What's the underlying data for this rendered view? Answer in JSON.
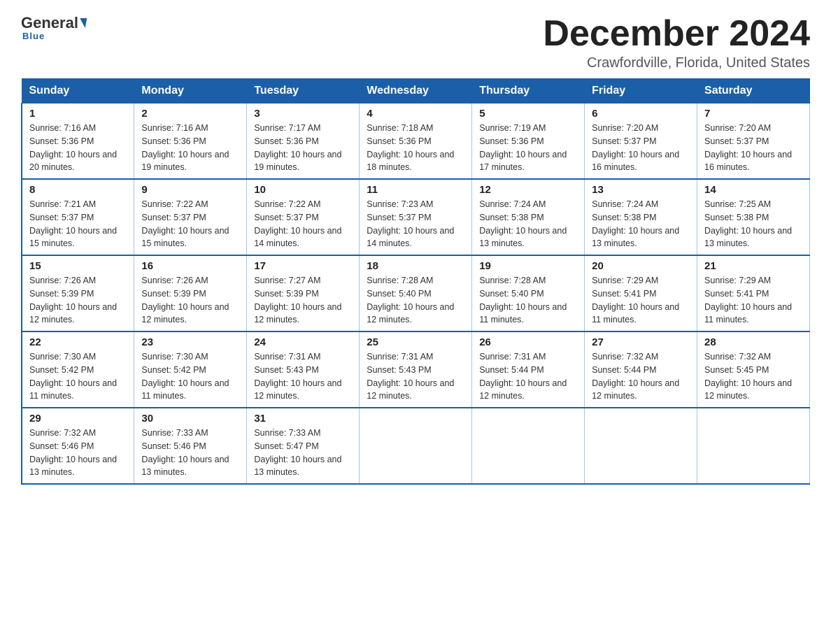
{
  "logo": {
    "general": "General",
    "blue": "Blue",
    "sub": "Blue"
  },
  "header": {
    "month_year": "December 2024",
    "location": "Crawfordville, Florida, United States"
  },
  "weekdays": [
    "Sunday",
    "Monday",
    "Tuesday",
    "Wednesday",
    "Thursday",
    "Friday",
    "Saturday"
  ],
  "weeks": [
    [
      {
        "day": "1",
        "sunrise": "Sunrise: 7:16 AM",
        "sunset": "Sunset: 5:36 PM",
        "daylight": "Daylight: 10 hours and 20 minutes."
      },
      {
        "day": "2",
        "sunrise": "Sunrise: 7:16 AM",
        "sunset": "Sunset: 5:36 PM",
        "daylight": "Daylight: 10 hours and 19 minutes."
      },
      {
        "day": "3",
        "sunrise": "Sunrise: 7:17 AM",
        "sunset": "Sunset: 5:36 PM",
        "daylight": "Daylight: 10 hours and 19 minutes."
      },
      {
        "day": "4",
        "sunrise": "Sunrise: 7:18 AM",
        "sunset": "Sunset: 5:36 PM",
        "daylight": "Daylight: 10 hours and 18 minutes."
      },
      {
        "day": "5",
        "sunrise": "Sunrise: 7:19 AM",
        "sunset": "Sunset: 5:36 PM",
        "daylight": "Daylight: 10 hours and 17 minutes."
      },
      {
        "day": "6",
        "sunrise": "Sunrise: 7:20 AM",
        "sunset": "Sunset: 5:37 PM",
        "daylight": "Daylight: 10 hours and 16 minutes."
      },
      {
        "day": "7",
        "sunrise": "Sunrise: 7:20 AM",
        "sunset": "Sunset: 5:37 PM",
        "daylight": "Daylight: 10 hours and 16 minutes."
      }
    ],
    [
      {
        "day": "8",
        "sunrise": "Sunrise: 7:21 AM",
        "sunset": "Sunset: 5:37 PM",
        "daylight": "Daylight: 10 hours and 15 minutes."
      },
      {
        "day": "9",
        "sunrise": "Sunrise: 7:22 AM",
        "sunset": "Sunset: 5:37 PM",
        "daylight": "Daylight: 10 hours and 15 minutes."
      },
      {
        "day": "10",
        "sunrise": "Sunrise: 7:22 AM",
        "sunset": "Sunset: 5:37 PM",
        "daylight": "Daylight: 10 hours and 14 minutes."
      },
      {
        "day": "11",
        "sunrise": "Sunrise: 7:23 AM",
        "sunset": "Sunset: 5:37 PM",
        "daylight": "Daylight: 10 hours and 14 minutes."
      },
      {
        "day": "12",
        "sunrise": "Sunrise: 7:24 AM",
        "sunset": "Sunset: 5:38 PM",
        "daylight": "Daylight: 10 hours and 13 minutes."
      },
      {
        "day": "13",
        "sunrise": "Sunrise: 7:24 AM",
        "sunset": "Sunset: 5:38 PM",
        "daylight": "Daylight: 10 hours and 13 minutes."
      },
      {
        "day": "14",
        "sunrise": "Sunrise: 7:25 AM",
        "sunset": "Sunset: 5:38 PM",
        "daylight": "Daylight: 10 hours and 13 minutes."
      }
    ],
    [
      {
        "day": "15",
        "sunrise": "Sunrise: 7:26 AM",
        "sunset": "Sunset: 5:39 PM",
        "daylight": "Daylight: 10 hours and 12 minutes."
      },
      {
        "day": "16",
        "sunrise": "Sunrise: 7:26 AM",
        "sunset": "Sunset: 5:39 PM",
        "daylight": "Daylight: 10 hours and 12 minutes."
      },
      {
        "day": "17",
        "sunrise": "Sunrise: 7:27 AM",
        "sunset": "Sunset: 5:39 PM",
        "daylight": "Daylight: 10 hours and 12 minutes."
      },
      {
        "day": "18",
        "sunrise": "Sunrise: 7:28 AM",
        "sunset": "Sunset: 5:40 PM",
        "daylight": "Daylight: 10 hours and 12 minutes."
      },
      {
        "day": "19",
        "sunrise": "Sunrise: 7:28 AM",
        "sunset": "Sunset: 5:40 PM",
        "daylight": "Daylight: 10 hours and 11 minutes."
      },
      {
        "day": "20",
        "sunrise": "Sunrise: 7:29 AM",
        "sunset": "Sunset: 5:41 PM",
        "daylight": "Daylight: 10 hours and 11 minutes."
      },
      {
        "day": "21",
        "sunrise": "Sunrise: 7:29 AM",
        "sunset": "Sunset: 5:41 PM",
        "daylight": "Daylight: 10 hours and 11 minutes."
      }
    ],
    [
      {
        "day": "22",
        "sunrise": "Sunrise: 7:30 AM",
        "sunset": "Sunset: 5:42 PM",
        "daylight": "Daylight: 10 hours and 11 minutes."
      },
      {
        "day": "23",
        "sunrise": "Sunrise: 7:30 AM",
        "sunset": "Sunset: 5:42 PM",
        "daylight": "Daylight: 10 hours and 11 minutes."
      },
      {
        "day": "24",
        "sunrise": "Sunrise: 7:31 AM",
        "sunset": "Sunset: 5:43 PM",
        "daylight": "Daylight: 10 hours and 12 minutes."
      },
      {
        "day": "25",
        "sunrise": "Sunrise: 7:31 AM",
        "sunset": "Sunset: 5:43 PM",
        "daylight": "Daylight: 10 hours and 12 minutes."
      },
      {
        "day": "26",
        "sunrise": "Sunrise: 7:31 AM",
        "sunset": "Sunset: 5:44 PM",
        "daylight": "Daylight: 10 hours and 12 minutes."
      },
      {
        "day": "27",
        "sunrise": "Sunrise: 7:32 AM",
        "sunset": "Sunset: 5:44 PM",
        "daylight": "Daylight: 10 hours and 12 minutes."
      },
      {
        "day": "28",
        "sunrise": "Sunrise: 7:32 AM",
        "sunset": "Sunset: 5:45 PM",
        "daylight": "Daylight: 10 hours and 12 minutes."
      }
    ],
    [
      {
        "day": "29",
        "sunrise": "Sunrise: 7:32 AM",
        "sunset": "Sunset: 5:46 PM",
        "daylight": "Daylight: 10 hours and 13 minutes."
      },
      {
        "day": "30",
        "sunrise": "Sunrise: 7:33 AM",
        "sunset": "Sunset: 5:46 PM",
        "daylight": "Daylight: 10 hours and 13 minutes."
      },
      {
        "day": "31",
        "sunrise": "Sunrise: 7:33 AM",
        "sunset": "Sunset: 5:47 PM",
        "daylight": "Daylight: 10 hours and 13 minutes."
      },
      null,
      null,
      null,
      null
    ]
  ]
}
